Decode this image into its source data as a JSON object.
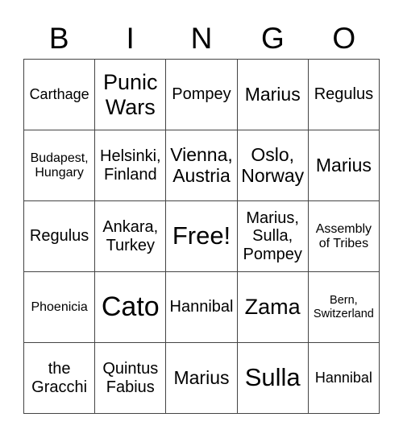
{
  "header": {
    "letters": [
      "B",
      "I",
      "N",
      "G",
      "O"
    ]
  },
  "cells": [
    [
      "Carthage",
      "Punic\nWars",
      "Pompey",
      "Marius",
      "Regulus"
    ],
    [
      "Budapest,\nHungary",
      "Helsinki,\nFinland",
      "Vienna,\nAustria",
      "Oslo,\nNorway",
      "Marius"
    ],
    [
      "Regulus",
      "Ankara,\nTurkey",
      "Free!",
      "Marius,\nSulla,\nPompey",
      "Assembly\nof Tribes"
    ],
    [
      "Phoenicia",
      "Cato",
      "Hannibal",
      "Zama",
      "Bern,\nSwitzerland"
    ],
    [
      "the\nGracchi",
      "Quintus\nFabius",
      "Marius",
      "Sulla",
      "Hannibal"
    ]
  ]
}
